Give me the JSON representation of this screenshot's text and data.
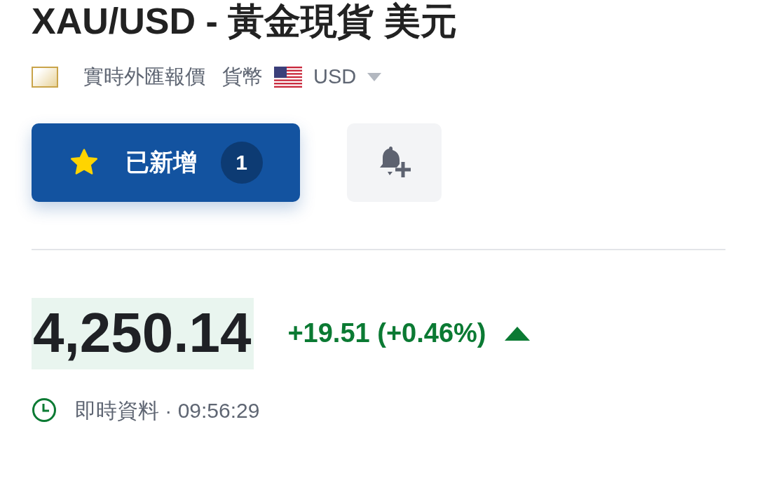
{
  "title": "XAU/USD - 黃金現貨 美元",
  "source": "實時外匯報價",
  "currency_label": "貨幣",
  "currency": "USD",
  "watchlist_button": {
    "label": "已新增",
    "count": "1"
  },
  "price": {
    "value": "4,250.14",
    "change": "+19.51 (+0.46%)",
    "rising": true
  },
  "status": {
    "text": "即時資料 · 09:56:29"
  }
}
